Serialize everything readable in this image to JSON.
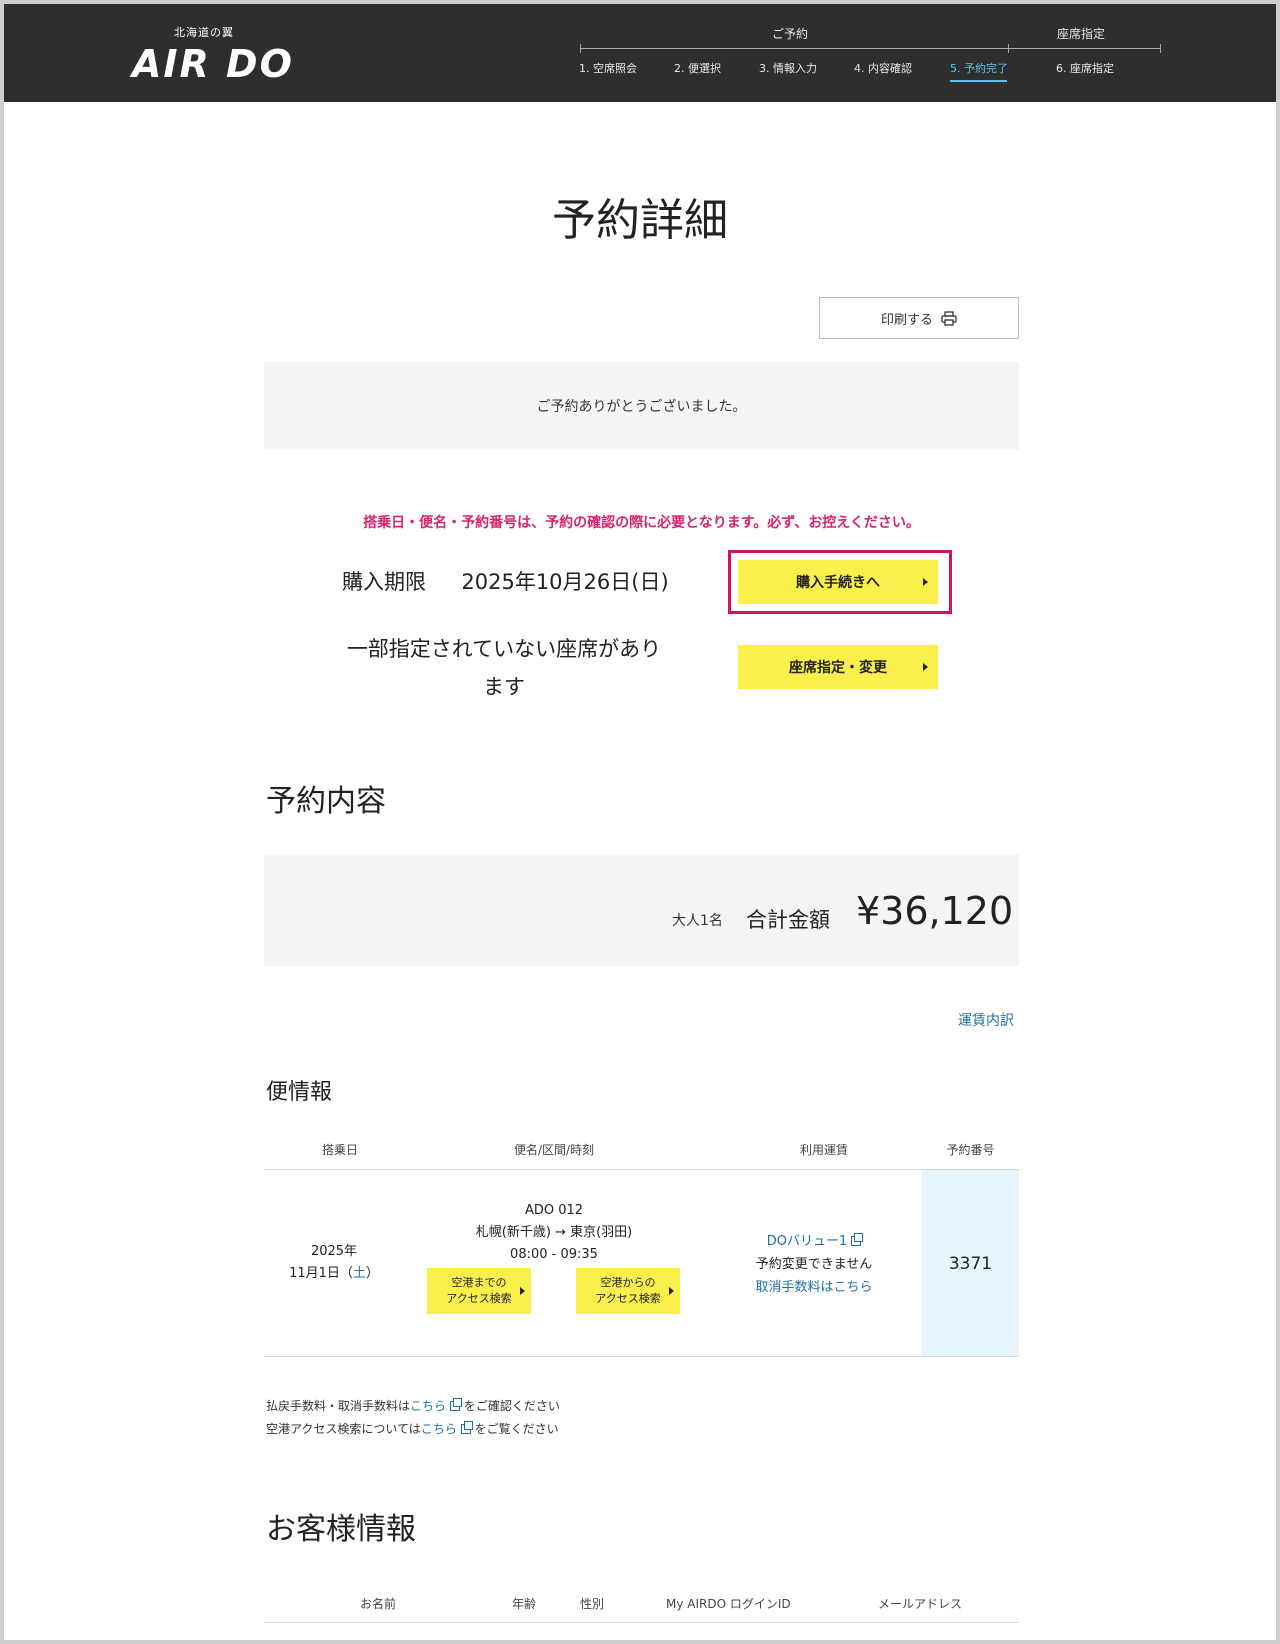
{
  "header": {
    "logo_sub": "北海道の翼",
    "logo": "AIR DO",
    "group_reservation": "ご予約",
    "group_seat": "座席指定",
    "steps": [
      "1. 空席照会",
      "2. 便選択",
      "3. 情報入力",
      "4. 内容確認",
      "5. 予約完了",
      "6. 座席指定"
    ],
    "active_step": "5. 予約完了"
  },
  "page_title": "予約詳細",
  "print_label": "印刷する",
  "thanks_message": "ご予約ありがとうございました。",
  "notice": "搭乗日・便名・予約番号は、予約の確認の際に必要となります。必ず、お控えください。",
  "deadline": {
    "label": "購入期限",
    "date": "2025年10月26日(日)",
    "button": "購入手続きへ"
  },
  "seat": {
    "message_line1": "一部指定されていない座席があり",
    "message_line2": "ます",
    "button": "座席指定・変更"
  },
  "reservation_heading": "予約内容",
  "total": {
    "passengers": "大人1名",
    "label": "合計金額",
    "amount": "¥36,120"
  },
  "fare_breakdown_link": "運賃内訳",
  "flight_heading": "便情報",
  "flight_table": {
    "headers": [
      "搭乗日",
      "便名/区間/時刻",
      "利用運賃",
      "予約番号"
    ],
    "row": {
      "date_year": "2025年",
      "date_day": "11月1日（",
      "date_dow": "土",
      "date_close": "）",
      "flight_no": "ADO 012",
      "route": "札幌(新千歳) → 東京(羽田)",
      "time": "08:00 - 09:35",
      "access_to_line1": "空港までの",
      "access_to_line2": "アクセス検索",
      "access_from_line1": "空港からの",
      "access_from_line2": "アクセス検索",
      "fare_name": "DOバリュー1",
      "fare_note": "予約変更できません",
      "fare_cancel_link": "取消手数料はこちら",
      "reservation_no": "3371"
    }
  },
  "notes": {
    "line1_pre": "払戻手数料・取消手数料は",
    "line1_link": "こちら",
    "line1_post": " をご確認ください",
    "line2_pre": "空港アクセス検索については",
    "line2_link": "こちら",
    "line2_post": " をご覧ください"
  },
  "customer_heading": "お客様情報",
  "customer_table": {
    "headers": [
      "お名前",
      "年齢",
      "性別",
      "My AIRDO ログインID",
      "メールアドレス"
    ]
  },
  "colors": {
    "header_bg": "#2e2e2e",
    "accent_blue": "#5cc2f2",
    "button_yellow": "#fbef4b",
    "notice_pink": "#d9246e",
    "highlight_border": "#d0135f",
    "link_blue": "#1f6fa6",
    "reservation_cell_bg": "#e6f4fb"
  },
  "icons": [
    "printer-icon",
    "external-link-icon",
    "caret-right-icon"
  ]
}
